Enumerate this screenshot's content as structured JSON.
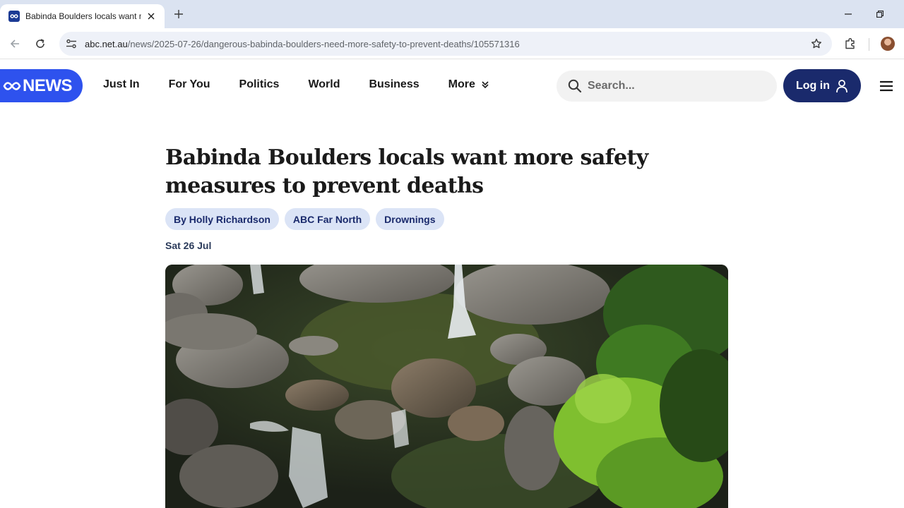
{
  "browser": {
    "tab": {
      "title": "Babinda Boulders locals want more safety measures to prevent deaths"
    },
    "url": {
      "host": "abc.net.au",
      "path": "/news/2025-07-26/dangerous-babinda-boulders-need-more-safety-to-prevent-deaths/105571316"
    }
  },
  "site": {
    "logo_text": "NEWS",
    "nav": [
      {
        "label": "Just In"
      },
      {
        "label": "For You"
      },
      {
        "label": "Politics"
      },
      {
        "label": "World"
      },
      {
        "label": "Business"
      },
      {
        "label": "More"
      }
    ],
    "search_placeholder": "Search...",
    "login_label": "Log in"
  },
  "article": {
    "headline": "Babinda Boulders locals want more safety measures to prevent deaths",
    "chips": [
      {
        "label": "By Holly Richardson"
      },
      {
        "label": "ABC Far North"
      },
      {
        "label": "Drownings"
      }
    ],
    "date": "Sat 26 Jul"
  },
  "colors": {
    "brand": "#2e52ee",
    "login_bg": "#1a2a6c",
    "chip_bg": "#dbe4f6",
    "chip_text": "#1a2a6c"
  }
}
